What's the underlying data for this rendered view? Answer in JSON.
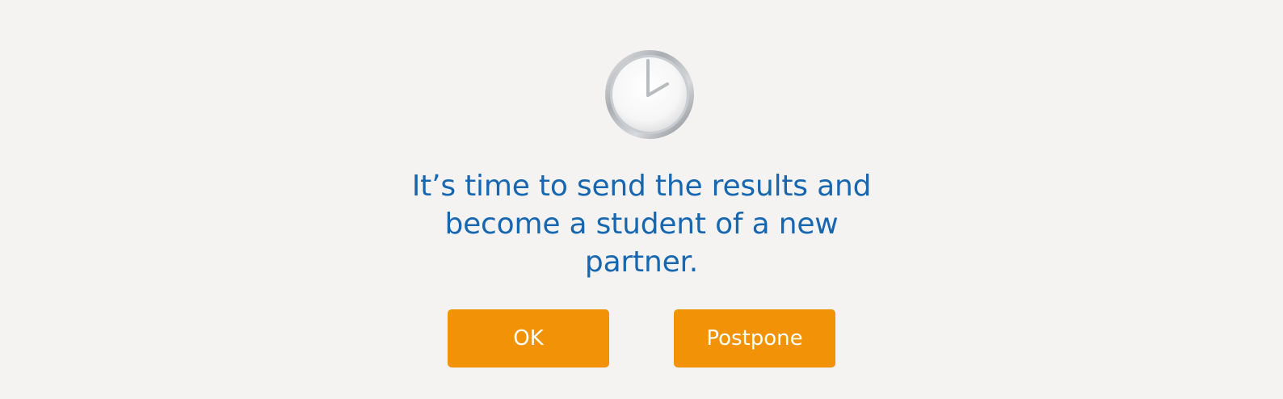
{
  "dialog": {
    "icon": "clock-icon",
    "message": "It’s time to send the results and become a student of a new partner.",
    "buttons": {
      "ok_label": "OK",
      "postpone_label": "Postpone"
    }
  },
  "colors": {
    "background": "#f4f3f2",
    "message_text": "#1666b0",
    "button_bg": "#f29206",
    "button_text": "#ffffff"
  }
}
